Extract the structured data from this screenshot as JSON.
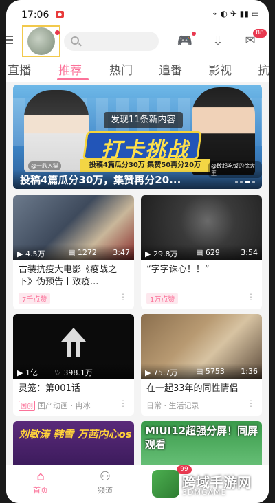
{
  "status_bar": {
    "time": "17:06",
    "right_text": "⌁ ◐ ✈ ▮▮ ▭"
  },
  "header": {
    "search_placeholder": "",
    "message_badge": "88"
  },
  "tabs": [
    {
      "label": "直播"
    },
    {
      "label": "推荐"
    },
    {
      "label": "热门"
    },
    {
      "label": "追番"
    },
    {
      "label": "影视"
    },
    {
      "label": "抗"
    }
  ],
  "banner": {
    "pill": "发现11条新内容",
    "title": "打卡挑战",
    "sub": "投稿4篇瓜分30万  集赞50再分20万",
    "tag_left": "@一欣入猫",
    "tag_right": "@敢起吃饭的徐大王",
    "caption": "投稿4篇瓜分30万，集赞再分20..."
  },
  "cards": [
    {
      "plays": "4.5万",
      "danmaku": "1272",
      "duration": "3:47",
      "title": "古装抗疫大电影《疫战之下》伪预告丨致疫...",
      "foot_tag": "7千点赞",
      "more": "⋮"
    },
    {
      "plays": "29.8万",
      "danmaku": "629",
      "duration": "3:54",
      "title": "“字字诛心！！”",
      "foot_tag": "1万点赞",
      "more": "⋮"
    },
    {
      "plays": "1亿",
      "danmaku": "398.1万",
      "duration": "",
      "title": "灵笼：第001话",
      "badge": "国创",
      "foot_text": "国产动画 · 冉冰",
      "more": "⋮"
    },
    {
      "plays": "75.7万",
      "danmaku": "5753",
      "duration": "1:36",
      "title": "在一起33年的同性情侣",
      "foot_text": "日常 · 生活记录",
      "more": "⋮"
    },
    {
      "thumb_text": "刘敏涛 韩雪 万茜内心os"
    },
    {
      "thumb_text": "MIUI12超强分屏！同屏观看"
    }
  ],
  "bottom_nav": [
    {
      "label": "首页"
    },
    {
      "label": "频道"
    }
  ],
  "nav_badge": "99",
  "watermark": {
    "text": "跨域手游网",
    "sub": "3DMGAME"
  },
  "colors": {
    "accent": "#fb7299",
    "badge": "#e8384f"
  }
}
